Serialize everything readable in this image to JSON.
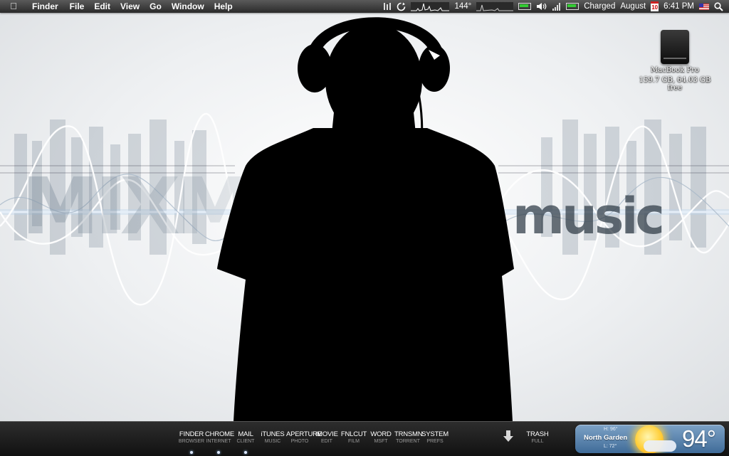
{
  "menubar": {
    "apple_icon": "apple-icon",
    "app_name": "Finder",
    "menus": [
      "File",
      "Edit",
      "View",
      "Go",
      "Window",
      "Help"
    ],
    "status": {
      "temperature": "144°",
      "battery_text": "Charged",
      "date_text": "August",
      "calendar_day": "10",
      "time": "6:41 PM"
    },
    "icons": [
      "cpu-meter-icon",
      "sync-icon",
      "activity-graph-icon",
      "network-graph-icon",
      "battery-icon",
      "volume-icon",
      "wifi-icon",
      "flag-icon",
      "spotlight-icon"
    ]
  },
  "desktop": {
    "drive": {
      "name": "MacBook Pro",
      "info": "159.7 GB, 64.03 GB free",
      "icon": "hard-drive-icon"
    }
  },
  "dock": {
    "items": [
      {
        "title": "FINDER",
        "sub": "BROWSER",
        "running": true
      },
      {
        "title": "CHROME",
        "sub": "INTERNET",
        "running": true
      },
      {
        "title": "MAIL",
        "sub": "CLIENT",
        "running": true
      },
      {
        "title": "iTUNES",
        "sub": "MUSIC",
        "running": false
      },
      {
        "title": "APERTURE",
        "sub": "PHOTO",
        "running": false
      },
      {
        "title": "iMOVIE",
        "sub": "EDIT",
        "running": false
      },
      {
        "title": "FNLCUT",
        "sub": "FILM",
        "running": false
      },
      {
        "title": "WORD",
        "sub": "MSFT",
        "running": false
      },
      {
        "title": "TRNSMN",
        "sub": "TORRENT",
        "running": false
      },
      {
        "title": "SYSTEM",
        "sub": "PREFS",
        "running": false
      }
    ],
    "downloads_icon": "download-arrow-icon",
    "trash": {
      "title": "TRASH",
      "sub": "FULL"
    }
  },
  "weather": {
    "high": "H: 96°",
    "city": "North Garden",
    "low": "L: 72°",
    "temp": "94°",
    "condition_icon": "partly-sunny-icon"
  },
  "colors": {
    "menubar": "#3a3a3a",
    "dock": "#1c1c1c",
    "widget_blue": "#5a86b2"
  }
}
